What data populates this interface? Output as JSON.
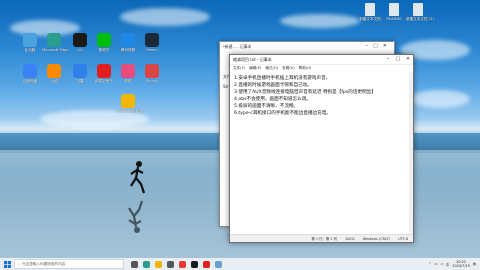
{
  "desktop_icons": [
    {
      "name": "此电脑",
      "color": "#4aa3df"
    },
    {
      "name": "Microsoft Edge",
      "color": "#2a9d8f"
    },
    {
      "name": "QQ",
      "color": "#1a1a1a"
    },
    {
      "name": "爱奇艺",
      "color": "#00be06"
    },
    {
      "name": "腾讯视频",
      "color": "#1e88e5"
    },
    {
      "name": "Steam",
      "color": "#1b2838"
    },
    {
      "name": "百度网盘",
      "color": "#3b82f6"
    },
    {
      "name": "火绒",
      "color": "#ff8a00"
    },
    {
      "name": "迅雷",
      "color": "#2f80ed"
    },
    {
      "name": "网易云音乐",
      "color": "#e02020"
    },
    {
      "name": "剪映",
      "color": "#e84c7f"
    },
    {
      "name": "Scrcpy",
      "color": "#d94444"
    },
    {
      "name": "Windows文件夹",
      "color": "#f2b705"
    }
  ],
  "top_right_files": [
    {
      "name": "新建文本文档",
      "color": "#dfe8f0"
    },
    {
      "name": "README",
      "color": "#dfe8f0"
    },
    {
      "name": "新建文本文档 (2)",
      "color": "#dfe8f0"
    }
  ],
  "back_window": {
    "title": "*新建... - 记事本",
    "side_labels": [
      "文件",
      "Str"
    ]
  },
  "notepad": {
    "title": "缩减项目.txt - 记事本",
    "menu": [
      "文件(F)",
      "编辑(E)",
      "格式(O)",
      "查看(V)",
      "帮助(H)"
    ],
    "lines": [
      "1.安卓手机直播时手机插上耳机没有游戏声音。",
      "2.直播的时候游戏画面卡顿和自己动。",
      "3.使用了AUX音频线连接电脑但声音有延迟  特别是【fps的话更明显】",
      "4.obs不会使用，画面不知道怎么调。",
      "5.投屏的画面不清晰，不流畅。",
      "6.type-c耳机接口的手机能不能边直播边充电。"
    ],
    "status": {
      "pos": "第 1 行，第 1 列",
      "zoom": "100%",
      "eol": "Windows (CRLF)",
      "enc": "UTF-8"
    }
  },
  "taskbar": {
    "search_placeholder": "在这里输入你要搜索的内容",
    "time": "20:22",
    "date": "2020/7/19",
    "apps": [
      {
        "name": "task-view",
        "color": "#555"
      },
      {
        "name": "edge",
        "color": "#2a9d8f"
      },
      {
        "name": "explorer",
        "color": "#f2b705"
      },
      {
        "name": "store",
        "color": "#555"
      },
      {
        "name": "chrome",
        "color": "#e53935"
      },
      {
        "name": "qq",
        "color": "#1a1a1a"
      },
      {
        "name": "music",
        "color": "#e02020"
      },
      {
        "name": "notepad",
        "color": "#6a9fd4"
      }
    ]
  }
}
